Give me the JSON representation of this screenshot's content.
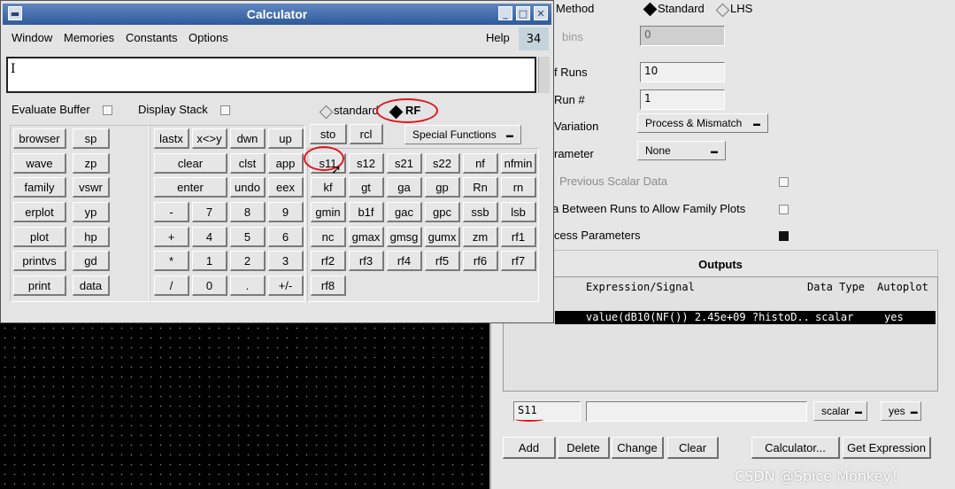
{
  "calculator": {
    "title": "Calculator",
    "menus": [
      "Window",
      "Memories",
      "Constants",
      "Options"
    ],
    "help": "Help",
    "badge": "34",
    "buffer_cursor": "I",
    "evaluate_buffer": "Evaluate Buffer",
    "display_stack": "Display Stack",
    "mode_standard": "standard",
    "mode_rf": "RF",
    "special_functions": "Special Functions",
    "left_keys": [
      [
        "browser",
        "sp"
      ],
      [
        "wave",
        "zp"
      ],
      [
        "family",
        "vswr"
      ],
      [
        "erplot",
        "yp"
      ],
      [
        "plot",
        "hp"
      ],
      [
        "printvs",
        "gd"
      ],
      [
        "print",
        "data"
      ]
    ],
    "mid_keys": {
      "row1": [
        "lastx",
        "x<>y",
        "dwn",
        "up"
      ],
      "row2_wide": "clear",
      "row2": [
        "clst",
        "app"
      ],
      "row3_wide": "enter",
      "row3": [
        "undo",
        "eex"
      ],
      "row4": [
        "-",
        "7",
        "8",
        "9"
      ],
      "row5": [
        "+",
        "4",
        "5",
        "6"
      ],
      "row6": [
        "*",
        "1",
        "2",
        "3"
      ],
      "row7": [
        "/",
        "0",
        ".",
        "+/-"
      ]
    },
    "rf_top": [
      "sto",
      "rcl"
    ],
    "rf_keys": [
      [
        "s11",
        "s12",
        "s21",
        "s22",
        "nf",
        "nfmin"
      ],
      [
        "kf",
        "gt",
        "ga",
        "gp",
        "Rn",
        "rn"
      ],
      [
        "gmin",
        "b1f",
        "gac",
        "gpc",
        "ssb",
        "lsb"
      ],
      [
        "nc",
        "gmax",
        "gmsg",
        "gumx",
        "zm",
        "rf1"
      ],
      [
        "rf2",
        "rf3",
        "rf4",
        "rf5",
        "rf6",
        "rf7"
      ],
      [
        "rf8"
      ]
    ]
  },
  "right": {
    "method_label": "Method",
    "standard": "Standard",
    "lhs": "LHS",
    "bins_label": "bins",
    "bins_value": "0",
    "runs_label": "f Runs",
    "runs_value": "10",
    "run_label": "Run #",
    "run_value": "1",
    "variation_label": "Variation",
    "variation_value": "Process & Mismatch",
    "parameter_label": "rameter",
    "parameter_value": "None",
    "prev_scalar": "Previous Scalar Data",
    "between_runs": "a Between Runs to Allow Family Plots",
    "process_params": "cess Parameters",
    "outputs_title": "Outputs",
    "col_expr": "Expression/Signal",
    "col_type": "Data Type",
    "col_autoplot": "Autoplot",
    "row_expr": "value(dB10(NF()) 2.45e+09 ?histoD..",
    "row_type": "scalar",
    "row_autoplot": "yes",
    "name_value": "S11",
    "expr_value": "",
    "type_combo": "scalar",
    "yes_combo": "yes",
    "buttons": [
      "Add",
      "Delete",
      "Change",
      "Clear",
      "Calculator...",
      "Get Expression"
    ]
  },
  "watermark": "CSDN @Spice Monkey！"
}
